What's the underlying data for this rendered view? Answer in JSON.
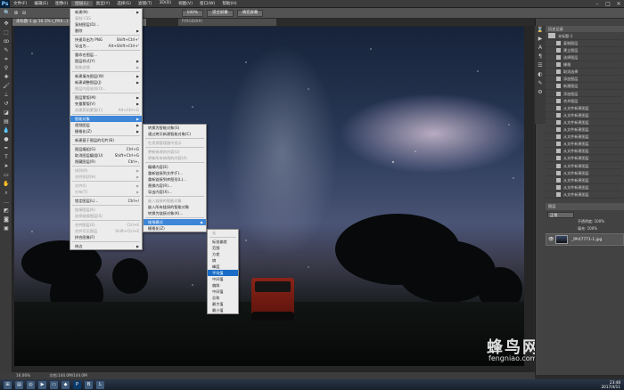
{
  "menubar": {
    "logo": "Ps",
    "items": [
      "文件(F)",
      "编辑(E)",
      "图像(I)",
      "图层(L)",
      "类型(Y)",
      "选择(S)",
      "滤镜(T)",
      "3D(D)",
      "视图(V)",
      "窗口(W)",
      "帮助(H)"
    ]
  },
  "options": {
    "b1": "100%",
    "b2": "适合屏幕",
    "b3": "填充屏幕"
  },
  "doc": {
    "tab": "未标题-1 @ 16.1% (_PAX...)",
    "tab2": "P(RGB/8#)"
  },
  "layer_menu": [
    {
      "label": "新建(N)",
      "arrow": true
    },
    {
      "label": "复制 CSS",
      "dis": true
    },
    {
      "label": "复制图层(D)..."
    },
    {
      "label": "删除",
      "arrow": true
    },
    {
      "sep": true
    },
    {
      "label": "快速导出为 PNG",
      "sc": "Shift+Ctrl+'"
    },
    {
      "label": "导出为...",
      "sc": "Alt+Shift+Ctrl+'"
    },
    {
      "sep": true
    },
    {
      "label": "重命名图层..."
    },
    {
      "label": "图层样式(Y)",
      "arrow": true
    },
    {
      "label": "智能滤镜",
      "arrow": true,
      "dis": true
    },
    {
      "sep": true
    },
    {
      "label": "新建填充图层(W)",
      "arrow": true
    },
    {
      "label": "新建调整图层(J)",
      "arrow": true
    },
    {
      "label": "图层内容选项(O)...",
      "dis": true
    },
    {
      "sep": true
    },
    {
      "label": "图层蒙版(M)",
      "arrow": true
    },
    {
      "label": "矢量蒙版(V)",
      "arrow": true
    },
    {
      "label": "创建剪贴蒙版(C)",
      "sc": "Alt+Ctrl+G",
      "dis": true
    },
    {
      "sep": true
    },
    {
      "label": "智能对象",
      "arrow": true,
      "hl": true
    },
    {
      "label": "视频图层",
      "arrow": true
    },
    {
      "label": "栅格化(Z)",
      "arrow": true
    },
    {
      "sep": true
    },
    {
      "label": "新建基于图层的切片(B)"
    },
    {
      "sep": true
    },
    {
      "label": "图层编组(G)",
      "sc": "Ctrl+G"
    },
    {
      "label": "取消图层编组(U)",
      "sc": "Shift+Ctrl+G"
    },
    {
      "label": "隐藏图层(R)",
      "sc": "Ctrl+,"
    },
    {
      "sep": true
    },
    {
      "label": "排列(A)",
      "arrow": true,
      "dis": true
    },
    {
      "label": "合并形状(H)",
      "arrow": true,
      "dis": true
    },
    {
      "sep": true
    },
    {
      "label": "对齐(I)",
      "arrow": true,
      "dis": true
    },
    {
      "label": "分布(T)",
      "arrow": true,
      "dis": true
    },
    {
      "sep": true
    },
    {
      "label": "锁定图层(L)...",
      "sc": "Ctrl+/"
    },
    {
      "sep": true
    },
    {
      "label": "链接图层(K)",
      "dis": true
    },
    {
      "label": "选择链接图层(S)",
      "dis": true
    },
    {
      "sep": true
    },
    {
      "label": "合并图层(E)",
      "sc": "Ctrl+E",
      "dis": true
    },
    {
      "label": "合并可见图层",
      "sc": "Shift+Ctrl+E",
      "dis": true
    },
    {
      "label": "拼合图像(F)"
    },
    {
      "sep": true
    },
    {
      "label": "修边",
      "arrow": true
    }
  ],
  "smart_menu": [
    {
      "label": "转换为智能对象(S)"
    },
    {
      "label": "通过拷贝新建智能对象(C)"
    },
    {
      "sep": true
    },
    {
      "label": "在资源管理器中显示",
      "dis": true
    },
    {
      "sep": true
    },
    {
      "label": "更新修改的内容(U)",
      "dis": true
    },
    {
      "label": "更新所有修改的内容(A)",
      "dis": true
    },
    {
      "sep": true
    },
    {
      "label": "编辑内容(E)"
    },
    {
      "label": "重新链接到文件(F)..."
    },
    {
      "label": "重新链接到库图形(L)..."
    },
    {
      "label": "替换内容(R)..."
    },
    {
      "label": "导出内容(X)..."
    },
    {
      "sep": true
    },
    {
      "label": "嵌入链接的智能对象",
      "dis": true
    },
    {
      "label": "嵌入所有链接的智能对象"
    },
    {
      "label": "转换为链接对象(K)..."
    },
    {
      "sep": true
    },
    {
      "label": "堆栈模式",
      "arrow": true,
      "hl": true
    },
    {
      "label": "栅格化(Z)"
    }
  ],
  "stack_menu": [
    {
      "label": "无",
      "dis": true
    },
    {
      "sep": true
    },
    {
      "label": "标准偏差"
    },
    {
      "label": "范围"
    },
    {
      "label": "方差"
    },
    {
      "label": "熵"
    },
    {
      "label": "峰度"
    },
    {
      "label": "平均值",
      "sel": true
    },
    {
      "label": "中间值"
    },
    {
      "label": "偏斜"
    },
    {
      "label": "中间值"
    },
    {
      "label": "总和"
    },
    {
      "label": "最大值"
    },
    {
      "label": "最小值"
    }
  ],
  "history": {
    "title": "历史记录",
    "items": [
      "未标题-1",
      "复制图层",
      "建立图层",
      "选择图层",
      "栅格",
      "取消选择",
      "添加图层",
      "新建图层",
      "添加图层",
      "合并图层",
      "从文件新建图层",
      "从文件新建图层",
      "从文件新建图层",
      "从文件新建图层",
      "从文件新建图层",
      "从文件新建图层",
      "从文件新建图层",
      "从文件新建图层",
      "从文件新建图层",
      "从文件新建图层",
      "从文件新建图层",
      "从文件新建图层",
      "从文件新建图层"
    ]
  },
  "layers": {
    "title": "图层",
    "blend": "正常",
    "opacity": "不透明度: 100%",
    "fill": "填充: 100%",
    "layer_name": "_PAX7771-1.jpg"
  },
  "status": {
    "zoom": "16.06%",
    "doc": "文档:144.0M/144.0M"
  },
  "watermark": {
    "cn": "蜂鸟网",
    "en": "fengniao.com"
  },
  "clock": {
    "time": "23:48",
    "date": "2017/4/11"
  }
}
